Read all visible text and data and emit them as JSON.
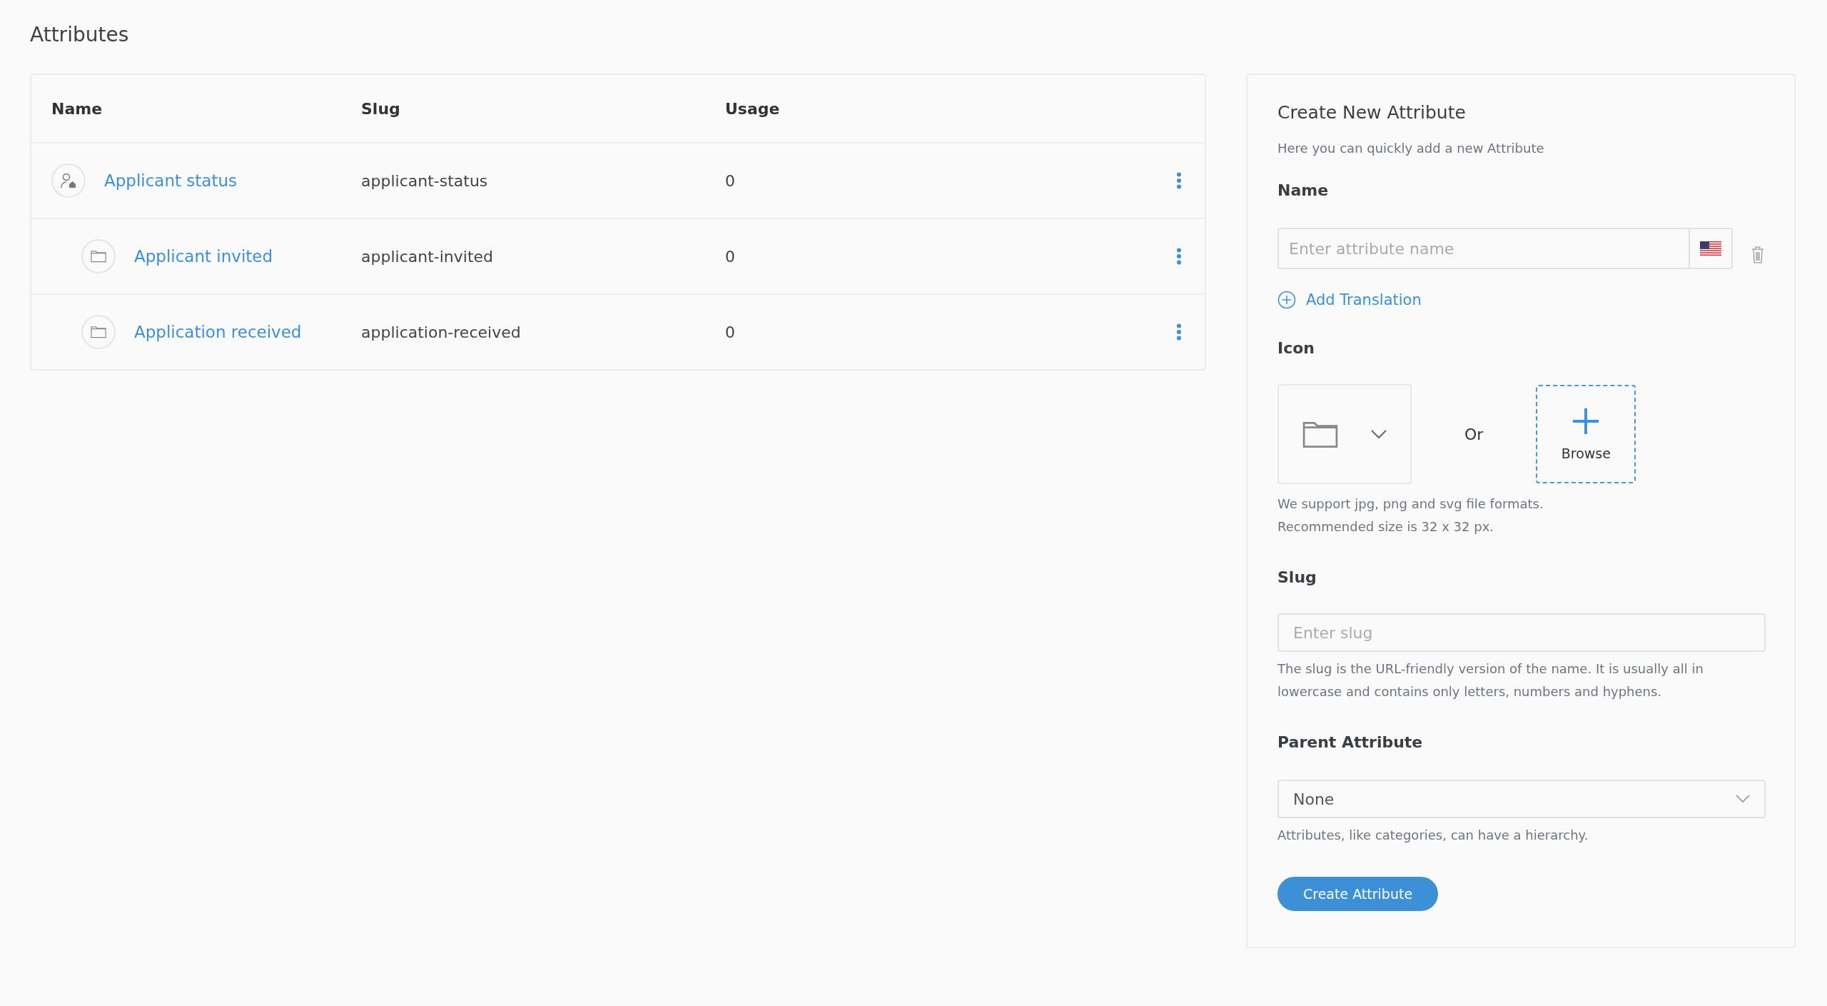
{
  "page_title": "Attributes",
  "table": {
    "columns": [
      "Name",
      "Slug",
      "Usage"
    ],
    "rows": [
      {
        "name": "Applicant status",
        "slug": "applicant-status",
        "usage": "0",
        "children": [
          {
            "name": "Applicant invited",
            "slug": "applicant-invited",
            "usage": "0"
          },
          {
            "name": "Application received",
            "slug": "application-received",
            "usage": "0"
          }
        ]
      }
    ]
  },
  "form": {
    "title": "Create New Attribute",
    "subtitle": "Here you can quickly add a new Attribute",
    "name_label": "Name",
    "name_field": {
      "placeholder": "Enter attribute name"
    },
    "add_translation": "Add Translation",
    "icon_label": "Icon",
    "or": "Or",
    "browse": "Browse",
    "icon_help": [
      "We support jpg, png and svg file formats.",
      "Recommended size is 32 x 32 px."
    ],
    "slug_label": "Slug",
    "slug_field": {
      "placeholder": "Enter slug"
    },
    "slug_help": "The slug is the URL-friendly version of the name. It is usually all in lowercase and contains only letters, numbers and hyphens.",
    "parent_label": "Parent Attribute",
    "parent_select": {
      "value": "None"
    },
    "parent_help": "Attributes, like categories, can have a hierarchy.",
    "submit": "Create Attribute"
  }
}
